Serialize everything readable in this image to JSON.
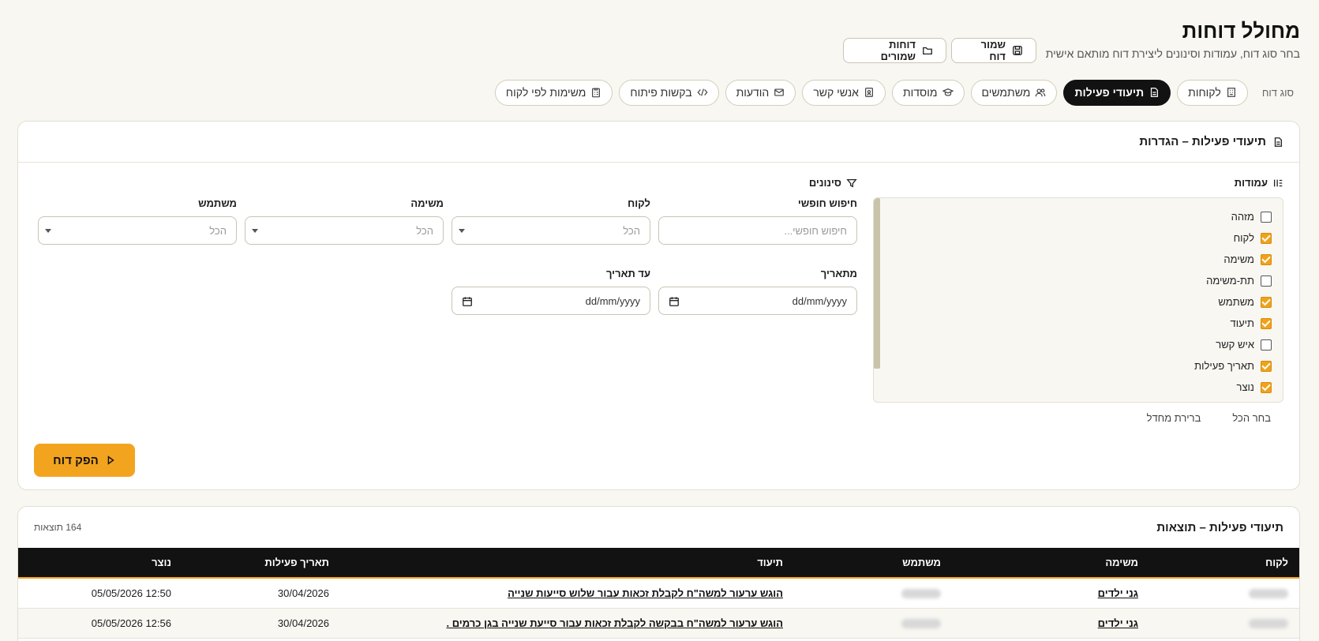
{
  "header": {
    "title": "מחולל דוחות",
    "subtitle": "בחר סוג דוח, עמודות וסינונים ליצירת דוח מותאם אישית",
    "save_label": "שמור דוח",
    "saved_label": "דוחות שמורים"
  },
  "report_types": {
    "label": "סוג דוח",
    "items": [
      {
        "label": "לקוחות",
        "icon": "building-icon",
        "active": false
      },
      {
        "label": "תיעודי פעילות",
        "icon": "document-icon",
        "active": true
      },
      {
        "label": "משתמשים",
        "icon": "users-icon",
        "active": false
      },
      {
        "label": "מוסדות",
        "icon": "graduation-cap-icon",
        "active": false
      },
      {
        "label": "אנשי קשר",
        "icon": "contact-card-icon",
        "active": false
      },
      {
        "label": "הודעות",
        "icon": "mail-icon",
        "active": false
      },
      {
        "label": "בקשות פיתוח",
        "icon": "code-icon",
        "active": false
      },
      {
        "label": "משימות לפי לקוח",
        "icon": "clipboard-list-icon",
        "active": false
      }
    ]
  },
  "settings": {
    "title": "תיעודי פעילות – הגדרות",
    "columns_title": "עמודות",
    "filters_title": "סינונים",
    "columns": [
      {
        "label": "מזהה",
        "checked": false
      },
      {
        "label": "לקוח",
        "checked": true
      },
      {
        "label": "משימה",
        "checked": true
      },
      {
        "label": "תת-משימה",
        "checked": false
      },
      {
        "label": "משתמש",
        "checked": true
      },
      {
        "label": "תיעוד",
        "checked": true
      },
      {
        "label": "איש קשר",
        "checked": false
      },
      {
        "label": "תאריך פעילות",
        "checked": true
      },
      {
        "label": "נוצר",
        "checked": true
      }
    ],
    "select_all": "בחר הכל",
    "reset_default": "ברירת מחדל",
    "filters": {
      "free_search_label": "חיפוש חופשי",
      "free_search_placeholder": "חיפוש חופשי...",
      "client_label": "לקוח",
      "client_value": "הכל",
      "task_label": "משימה",
      "task_value": "הכל",
      "user_label": "משתמש",
      "user_value": "הכל",
      "from_date_label": "מתאריך",
      "from_date_value": "dd/mm/yyyy",
      "to_date_label": "עד תאריך",
      "to_date_value": "dd/mm/yyyy"
    },
    "run_label": "הפק דוח"
  },
  "results": {
    "title": "תיעודי פעילות – תוצאות",
    "count": "164 תוצאות",
    "headers": [
      "לקוח",
      "משימה",
      "משתמש",
      "תיעוד",
      "תאריך פעילות",
      "נוצר"
    ],
    "rows": [
      {
        "task": "גני ילדים",
        "doc": "הוגש ערעור למשה\"ח לקבלת זכאות עבור שלוש סייעות שנייה",
        "date": "30/04/2026",
        "created": "12:50 05/05/2026"
      },
      {
        "task": "גני ילדים",
        "doc": "הוגש ערעור למשה\"ח בבקשה לקבלת זכאות עבור סייעת שנייה בגן כרמים .",
        "date": "30/04/2026",
        "created": "12:56 05/05/2026"
      }
    ]
  },
  "colors": {
    "accent": "#f3a41f",
    "dark": "#121212",
    "background": "#f8f7f2"
  }
}
